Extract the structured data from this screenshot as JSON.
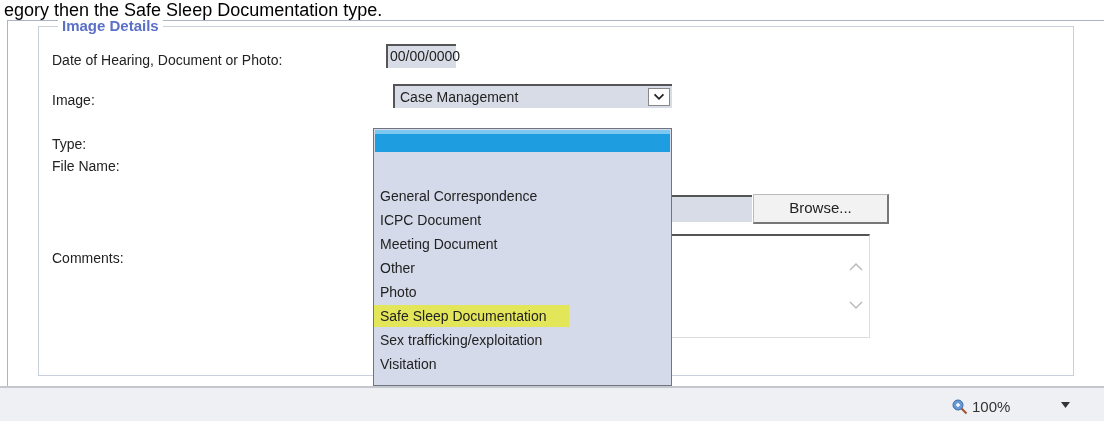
{
  "caption": "egory then the Safe Sleep Documentation type.",
  "section": {
    "legend": "Image Details"
  },
  "fields": [
    {
      "label": "Date of Hearing, Document or Photo:",
      "value": "00/00/0000"
    },
    {
      "label": "Image:",
      "value": "Case Management"
    },
    {
      "label": "Type:"
    },
    {
      "label": "File Name:"
    },
    {
      "label": "Comments:"
    }
  ],
  "browse_button": "Browse...",
  "dropdown": [
    {
      "kind": "blank",
      "selected": true
    },
    {
      "kind": "option",
      "label": "General Correspondence",
      "highlighted": false
    },
    {
      "kind": "option",
      "label": "ICPC Document",
      "highlighted": false
    },
    {
      "kind": "option",
      "label": "Meeting Document",
      "highlighted": false
    },
    {
      "kind": "option",
      "label": "Other",
      "highlighted": false
    },
    {
      "kind": "option",
      "label": "Photo",
      "highlighted": false
    },
    {
      "kind": "option",
      "label": "Safe Sleep Documentation",
      "highlighted": true
    },
    {
      "kind": "option",
      "label": "Sex trafficking/exploitation",
      "highlighted": false
    },
    {
      "kind": "option",
      "label": "Visitation",
      "highlighted": false
    }
  ],
  "status_bar": {
    "zoom": "100%"
  }
}
